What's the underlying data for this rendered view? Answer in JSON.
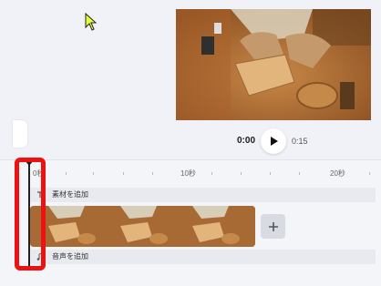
{
  "player": {
    "current_time": "0:00",
    "total_time": "0:15"
  },
  "ruler": {
    "labels": [
      "0秒",
      "10秒",
      "20秒"
    ]
  },
  "tracks": {
    "material_label": "素材を追加",
    "audio_label": "音声を追加"
  },
  "icons": {
    "cursor": "arrow-cursor-icon",
    "play": "play-icon",
    "add": "plus-icon"
  },
  "colors": {
    "highlight": "#ee1111",
    "stage_bg": "#f1f2f7",
    "cursor_fill": "#e8ff3a"
  }
}
